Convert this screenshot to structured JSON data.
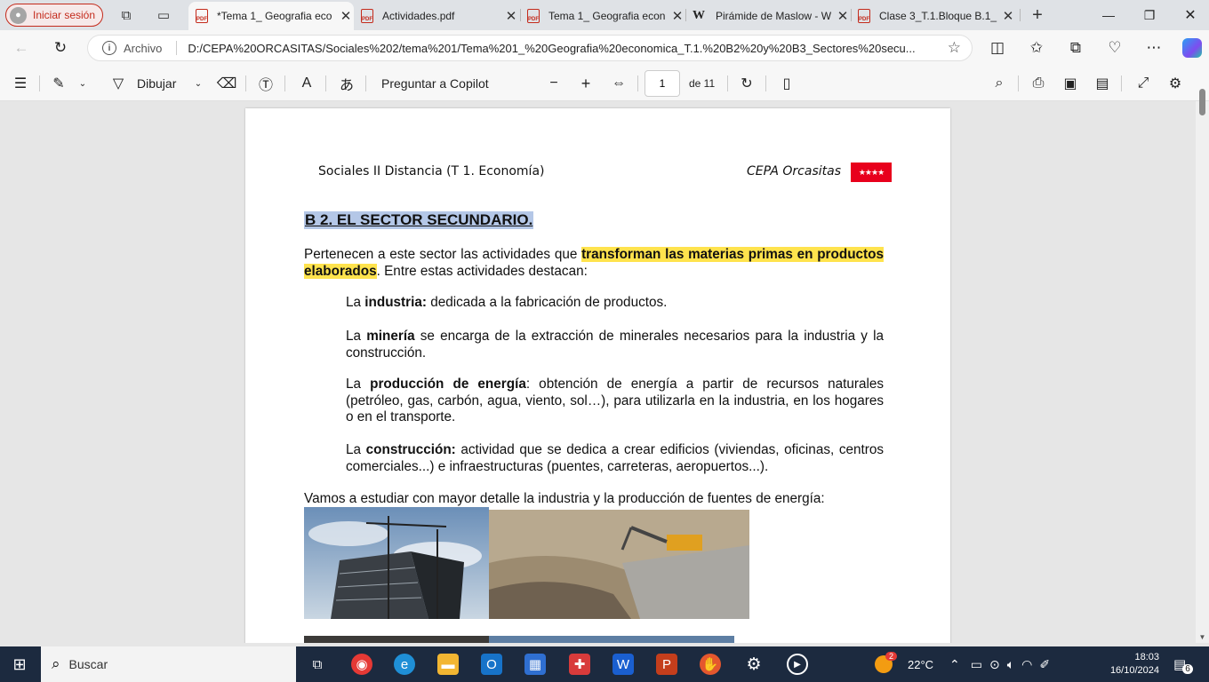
{
  "browser": {
    "profile_label": "Iniciar sesión",
    "tabs": [
      {
        "title": "*Tema 1_ Geografia eco",
        "icon": "pdf-icon",
        "active": true
      },
      {
        "title": "Actividades.pdf",
        "icon": "pdf-icon",
        "active": false
      },
      {
        "title": "Tema 1_ Geografia econ",
        "icon": "pdf-icon",
        "active": false
      },
      {
        "title": "Pirámide de Maslow - W",
        "icon": "wikipedia-icon",
        "active": false
      },
      {
        "title": "Clase 3_T.1.Bloque B.1_",
        "icon": "pdf-icon",
        "active": false
      }
    ],
    "address": {
      "scheme_label": "Archivo",
      "url": "D:/CEPA%20ORCASITAS/Sociales%202/tema%201/Tema%201_%20Geografia%20economica_T.1.%20B2%20y%20B3_Sectores%20secu..."
    }
  },
  "pdf_toolbar": {
    "draw_label": "Dibujar",
    "copilot_label": "Preguntar a Copilot",
    "page_current": "1",
    "page_total_label": "de 11"
  },
  "document": {
    "header_left": "Sociales II  Distancia (T 1. Economía)",
    "header_right": "CEPA Orcasitas",
    "flag_stars": "★★★★",
    "section_title": "B 2. EL SECTOR SECUNDARIO.",
    "intro_pre": "Pertenecen a este sector las actividades que ",
    "intro_highlight": "transforman las materias primas en productos elaborados",
    "intro_post": ". Entre estas actividades destacan:",
    "items": [
      {
        "pre": "La ",
        "bold": "industria:",
        "text": " dedicada a la fabricación de productos."
      },
      {
        "pre": "La ",
        "bold": "minería",
        "text": " se encarga de la extracción de minerales necesarios para la industria y la construcción."
      },
      {
        "pre": "La ",
        "bold": "producción de energía",
        "text": ": obtención de energía a partir de recursos naturales (petróleo, gas, carbón, agua, viento, sol…), para utilizarla en la industria, en los hogares o en el transporte."
      },
      {
        "pre": "La ",
        "bold": "construcción:",
        "text": " actividad que se dedica a crear edificios (viviendas, oficinas, centros comerciales...) e infraestructuras (puentes, carreteras, aeropuertos...)."
      }
    ],
    "closing": "Vamos a estudiar con mayor detalle la industria y la producción de fuentes de energía:"
  },
  "taskbar": {
    "search_label": "Buscar",
    "weather_temp": "22°C",
    "weather_badge": "2",
    "time": "18:03",
    "date": "16/10/2024",
    "notif_count": "6"
  },
  "colors": {
    "highlight_yellow": "#ffe34d",
    "title_blue": "#b4c7e7",
    "profile_red": "#c42b1c",
    "flag_red": "#e8001c",
    "taskbar": "#1c2a3f"
  }
}
